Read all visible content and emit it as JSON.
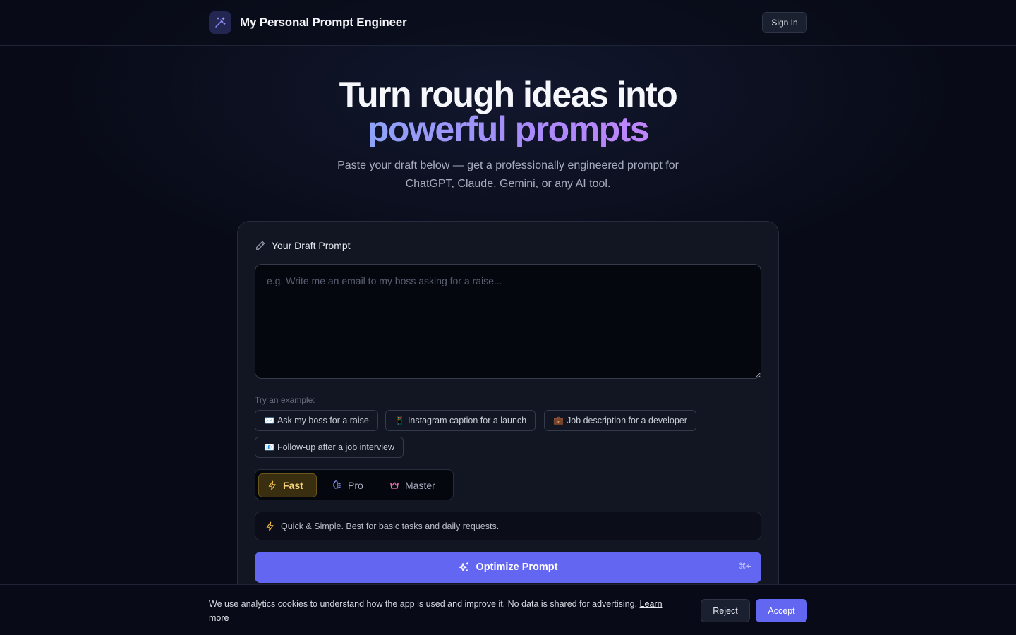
{
  "header": {
    "title": "My Personal Prompt Engineer",
    "brand_icon": "magic-wand-icon",
    "sign_in_label": "Sign In"
  },
  "hero": {
    "title_line1": "Turn rough ideas into",
    "title_line2": "powerful prompts",
    "subtitle": "Paste your draft below — get a professionally engineered prompt for ChatGPT, Claude, Gemini, or any AI tool."
  },
  "draft": {
    "label": "Your Draft Prompt",
    "label_icon": "pencil-icon",
    "value": "",
    "placeholder": "e.g. Write me an email to my boss asking for a raise..."
  },
  "examples": {
    "label": "Try an example:",
    "items": [
      {
        "emoji": "✉️",
        "label": "Ask my boss for a raise"
      },
      {
        "emoji": "📱",
        "label": "Instagram caption for a launch"
      },
      {
        "emoji": "💼",
        "label": "Job description for a developer"
      },
      {
        "emoji": "📧",
        "label": "Follow-up after a job interview"
      }
    ]
  },
  "modes": {
    "selected": "Fast",
    "items": [
      {
        "label": "Fast",
        "icon": "lightning-icon",
        "color": "#f6c244"
      },
      {
        "label": "Pro",
        "icon": "brain-icon",
        "color": "#8b9cf7"
      },
      {
        "label": "Master",
        "icon": "crown-icon",
        "color": "#f472b6"
      }
    ],
    "description": "Quick & Simple. Best for basic tasks and daily requests."
  },
  "optimize": {
    "label": "Optimize Prompt",
    "icon": "sparkles-icon",
    "shortcut": "⌘↵"
  },
  "cookie": {
    "text": "We use analytics cookies to understand how the app is used and improve it. No data is shared for advertising.",
    "link": "Learn more",
    "reject_label": "Reject",
    "accept_label": "Accept"
  },
  "colors": {
    "accent": "#6366f1",
    "background": "#080b17",
    "card": "#121623",
    "gradient_start": "#8ea3f7",
    "gradient_end": "#c084fc"
  }
}
